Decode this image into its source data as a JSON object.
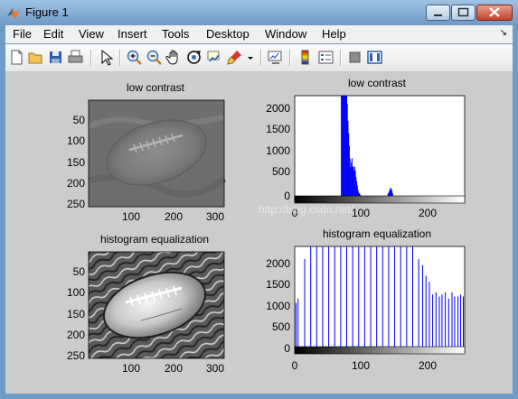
{
  "window": {
    "title": "Figure 1"
  },
  "menu": [
    "File",
    "Edit",
    "View",
    "Insert",
    "Tools",
    "Desktop",
    "Window",
    "Help"
  ],
  "toolbar_icons": [
    "new-figure-icon",
    "open-file-icon",
    "save-icon",
    "print-icon",
    "pointer-icon",
    "zoom-in-icon",
    "zoom-out-icon",
    "pan-hand-icon",
    "rotate-3d-icon",
    "data-cursor-icon",
    "brush-icon",
    "brush-dropdown-icon",
    "link-plot-icon",
    "colorbar-icon",
    "legend-icon",
    "hide-plot-tools-icon",
    "show-plot-tools-icon"
  ],
  "watermark": "http://blog.csdn.net/",
  "axes": {
    "img1": {
      "title": "low contrast",
      "xticks": [
        "100",
        "200",
        "300"
      ],
      "yticks": [
        "50",
        "100",
        "150",
        "200",
        "250"
      ]
    },
    "hist1": {
      "title": "low contrast",
      "xticks": [
        "0",
        "100",
        "200"
      ],
      "yticks": [
        "0",
        "500",
        "1000",
        "1500",
        "2000"
      ]
    },
    "img2": {
      "title": "histogram equalization",
      "xticks": [
        "100",
        "200",
        "300"
      ],
      "yticks": [
        "50",
        "100",
        "150",
        "200",
        "250"
      ]
    },
    "hist2": {
      "title": "histogram equalization",
      "xticks": [
        "0",
        "100",
        "200"
      ],
      "yticks": [
        "0",
        "500",
        "1000",
        "1500",
        "2000"
      ]
    }
  },
  "chart_data": [
    {
      "type": "bar",
      "title": "low contrast",
      "xlim": [
        0,
        255
      ],
      "ylim": [
        0,
        2400
      ],
      "color": "#0000ff",
      "bars": [
        {
          "x": 70,
          "y": 2400
        },
        {
          "x": 71,
          "y": 2400
        },
        {
          "x": 72,
          "y": 2400
        },
        {
          "x": 73,
          "y": 2400
        },
        {
          "x": 74,
          "y": 2400
        },
        {
          "x": 75,
          "y": 2400
        },
        {
          "x": 76,
          "y": 2400
        },
        {
          "x": 77,
          "y": 2400
        },
        {
          "x": 78,
          "y": 2400
        },
        {
          "x": 79,
          "y": 2200
        },
        {
          "x": 80,
          "y": 1800
        },
        {
          "x": 81,
          "y": 1500
        },
        {
          "x": 82,
          "y": 1200
        },
        {
          "x": 83,
          "y": 900
        },
        {
          "x": 84,
          "y": 700
        },
        {
          "x": 85,
          "y": 800
        },
        {
          "x": 86,
          "y": 900
        },
        {
          "x": 87,
          "y": 700
        },
        {
          "x": 88,
          "y": 700
        },
        {
          "x": 89,
          "y": 600
        },
        {
          "x": 90,
          "y": 700
        },
        {
          "x": 91,
          "y": 600
        },
        {
          "x": 92,
          "y": 450
        },
        {
          "x": 93,
          "y": 350
        },
        {
          "x": 94,
          "y": 250
        },
        {
          "x": 95,
          "y": 150
        },
        {
          "x": 96,
          "y": 80
        },
        {
          "x": 97,
          "y": 60
        },
        {
          "x": 98,
          "y": 40
        },
        {
          "x": 140,
          "y": 50
        },
        {
          "x": 141,
          "y": 80
        },
        {
          "x": 142,
          "y": 120
        },
        {
          "x": 143,
          "y": 160
        },
        {
          "x": 144,
          "y": 190
        },
        {
          "x": 145,
          "y": 170
        },
        {
          "x": 146,
          "y": 120
        },
        {
          "x": 147,
          "y": 60
        }
      ]
    },
    {
      "type": "bar",
      "title": "histogram equalization",
      "xlim": [
        0,
        255
      ],
      "ylim": [
        0,
        2400
      ],
      "color": "#0000ff",
      "bars": [
        {
          "x": 2,
          "y": 1050
        },
        {
          "x": 5,
          "y": 1150
        },
        {
          "x": 15,
          "y": 2100
        },
        {
          "x": 24,
          "y": 2400
        },
        {
          "x": 33,
          "y": 2400
        },
        {
          "x": 42,
          "y": 2400
        },
        {
          "x": 51,
          "y": 2400
        },
        {
          "x": 60,
          "y": 2400
        },
        {
          "x": 69,
          "y": 2400
        },
        {
          "x": 78,
          "y": 2400
        },
        {
          "x": 87,
          "y": 2400
        },
        {
          "x": 96,
          "y": 2400
        },
        {
          "x": 105,
          "y": 2400
        },
        {
          "x": 114,
          "y": 2400
        },
        {
          "x": 123,
          "y": 2400
        },
        {
          "x": 132,
          "y": 2400
        },
        {
          "x": 141,
          "y": 2400
        },
        {
          "x": 150,
          "y": 2400
        },
        {
          "x": 159,
          "y": 2400
        },
        {
          "x": 168,
          "y": 2400
        },
        {
          "x": 177,
          "y": 2400
        },
        {
          "x": 186,
          "y": 2100
        },
        {
          "x": 192,
          "y": 1950
        },
        {
          "x": 197,
          "y": 1700
        },
        {
          "x": 202,
          "y": 1550
        },
        {
          "x": 207,
          "y": 1250
        },
        {
          "x": 212,
          "y": 1300
        },
        {
          "x": 217,
          "y": 1200
        },
        {
          "x": 221,
          "y": 1250
        },
        {
          "x": 226,
          "y": 1300
        },
        {
          "x": 231,
          "y": 1150
        },
        {
          "x": 236,
          "y": 1300
        },
        {
          "x": 240,
          "y": 1200
        },
        {
          "x": 245,
          "y": 1200
        },
        {
          "x": 249,
          "y": 1250
        },
        {
          "x": 253,
          "y": 1200
        }
      ]
    }
  ]
}
